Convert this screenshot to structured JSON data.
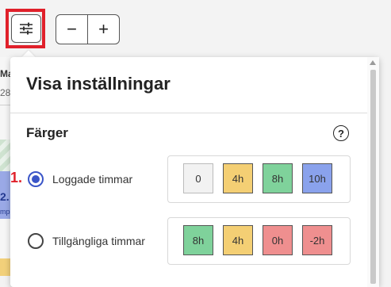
{
  "toolbar": {
    "settings_icon": "sliders-icon",
    "zoom_out_label": "−",
    "zoom_in_label": "+"
  },
  "background": {
    "day_label": "Mar",
    "date_label": "28",
    "hours_value": "2.",
    "hours_sub": "mp"
  },
  "panel": {
    "title": "Visa inställningar",
    "colors_section": {
      "title": "Färger",
      "help_icon_text": "?",
      "options": [
        {
          "label": "Loggade timmar",
          "selected": true,
          "chips": [
            {
              "label": "0",
              "color": "#f2f2f2"
            },
            {
              "label": "4h",
              "color": "#f4cf74"
            },
            {
              "label": "8h",
              "color": "#7fd29b"
            },
            {
              "label": "10h",
              "color": "#8aa2ec"
            }
          ]
        },
        {
          "label": "Tillgängliga timmar",
          "selected": false,
          "chips": [
            {
              "label": "8h",
              "color": "#7fd29b"
            },
            {
              "label": "4h",
              "color": "#f4cf74"
            },
            {
              "label": "0h",
              "color": "#ef8f8f"
            },
            {
              "label": "-2h",
              "color": "#ef8f8f"
            }
          ]
        }
      ]
    }
  },
  "annotation": {
    "step_label": "1.",
    "highlight_color": "#e0202a"
  }
}
